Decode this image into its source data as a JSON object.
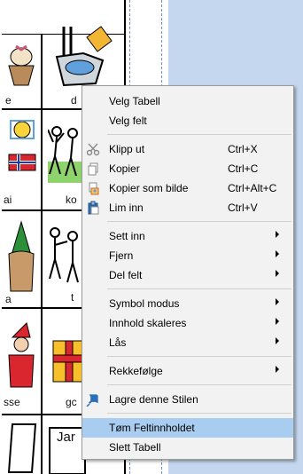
{
  "cells": {
    "row1_left_label": "e",
    "row1_mid_label": "d",
    "row2_left_label": "ai",
    "row2_mid_label": "ko",
    "row3_left_label": "a",
    "row3_mid_label": "t",
    "row4_left_label": "sse",
    "row4_mid_label": "gc",
    "row5_mid_label": "Jar"
  },
  "menu": {
    "items": [
      {
        "label": "Velg Tabell"
      },
      {
        "label": "Velg felt"
      },
      {
        "label": "Klipp ut",
        "shortcut": "Ctrl+X",
        "icon": "scissors-icon"
      },
      {
        "label": "Kopier",
        "shortcut": "Ctrl+C",
        "icon": "copy-icon"
      },
      {
        "label": "Kopier som bilde",
        "shortcut": "Ctrl+Alt+C",
        "icon": "copy-as-image-icon"
      },
      {
        "label": "Lim inn",
        "shortcut": "Ctrl+V",
        "icon": "paste-icon"
      },
      {
        "label": "Sett inn",
        "submenu": true
      },
      {
        "label": "Fjern",
        "submenu": true
      },
      {
        "label": "Del felt",
        "submenu": true
      },
      {
        "label": "Symbol modus",
        "submenu": true
      },
      {
        "label": "Innhold skaleres",
        "submenu": true
      },
      {
        "label": "Lås",
        "submenu": true
      },
      {
        "label": "Rekkefølge",
        "submenu": true
      },
      {
        "label": "Lagre denne Stilen",
        "icon": "pin-icon"
      },
      {
        "label": "Tøm Feltinnholdet",
        "highlighted": true
      },
      {
        "label": "Slett Tabell"
      }
    ]
  },
  "colors": {
    "highlight": "#a9cdf0",
    "menu_bg": "#f2f2f2",
    "workspace_bg": "#c4d7ee"
  }
}
